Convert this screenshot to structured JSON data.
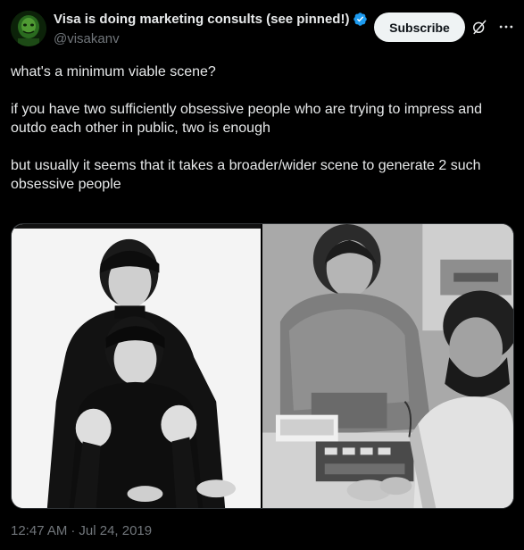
{
  "author": {
    "display_name": "Visa is doing marketing consults (see pinned!)",
    "handle": "@visakanv",
    "verified": true,
    "verified_color": "#1d9bf0"
  },
  "actions": {
    "subscribe_label": "Subscribe",
    "grok_icon": "grok-slash-icon",
    "more_icon": "more-horizontal-icon"
  },
  "tweet": {
    "paragraphs": [
      "what's a minimum viable scene?",
      "if you have two sufficiently obsessive people who are trying to impress and outdo each other in public, two is enough",
      "but usually it seems that it takes a broader/wider scene to generate 2 such obsessive people"
    ]
  },
  "media": {
    "photos": [
      {
        "name": "left-photo-two-men-in-black-turtlenecks"
      },
      {
        "name": "right-photo-two-men-with-circuit-board"
      }
    ]
  },
  "meta": {
    "time": "12:47 AM",
    "separator": "·",
    "date": "Jul 24, 2019"
  },
  "colors": {
    "background": "#000000",
    "text": "#e7e9ea",
    "secondary_text": "#71767b",
    "button_bg": "#eff3f4",
    "button_text": "#0f1419"
  }
}
